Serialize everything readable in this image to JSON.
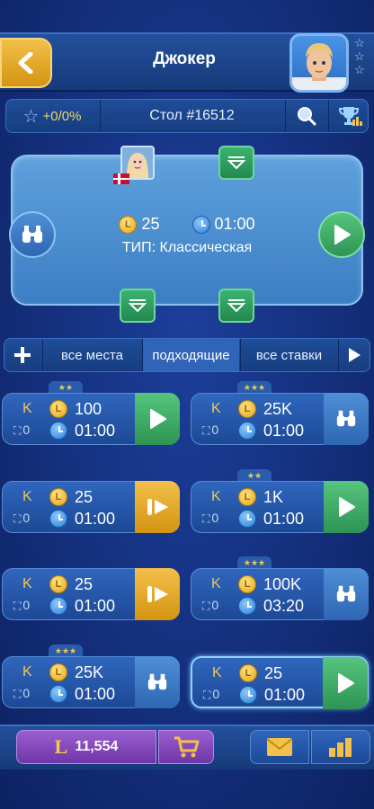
{
  "header": {
    "title": "Джокер",
    "rank_stars": [
      "☆",
      "☆",
      "☆"
    ]
  },
  "infobar": {
    "rating": "+0/0%",
    "table_label": "Стол #16512"
  },
  "current_table": {
    "bet": "25",
    "time": "01:00",
    "type": "ТИП: Классическая"
  },
  "filters": [
    "все места",
    "подходящие",
    "все ставки"
  ],
  "tables": [
    {
      "k": "K",
      "spectators": "0",
      "bet": "100",
      "time": "01:00",
      "action": "play",
      "stars": "★★"
    },
    {
      "k": "K",
      "spectators": "0",
      "bet": "25K",
      "time": "01:00",
      "action": "watch",
      "stars": "★★★"
    },
    {
      "k": "K",
      "spectators": "0",
      "bet": "25",
      "time": "01:00",
      "action": "join",
      "stars": ""
    },
    {
      "k": "K",
      "spectators": "0",
      "bet": "1K",
      "time": "01:00",
      "action": "play",
      "stars": "★★"
    },
    {
      "k": "K",
      "spectators": "0",
      "bet": "25",
      "time": "01:00",
      "action": "join",
      "stars": ""
    },
    {
      "k": "K",
      "spectators": "0",
      "bet": "100K",
      "time": "03:20",
      "action": "watch",
      "stars": "★★★"
    },
    {
      "k": "K",
      "spectators": "0",
      "bet": "25K",
      "time": "01:00",
      "action": "watch",
      "stars": "★★★"
    },
    {
      "k": "K",
      "spectators": "0",
      "bet": "25",
      "time": "01:00",
      "action": "play",
      "stars": ""
    }
  ],
  "footer": {
    "balance": "11,554",
    "currency_symbol": "L"
  },
  "colors": {
    "accent_green": "#3cb36f",
    "accent_gold": "#e3a412",
    "purple": "#8a4fc4",
    "bg": "#142f7c"
  }
}
